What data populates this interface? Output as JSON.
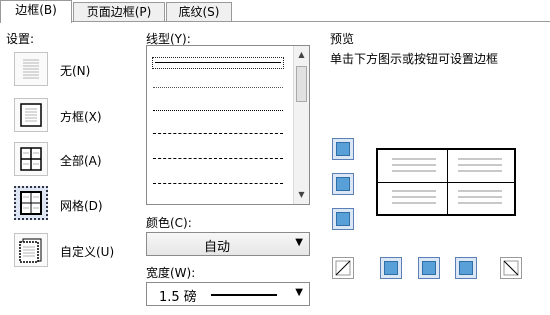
{
  "tabs": [
    {
      "label": "边框(B)",
      "active": true
    },
    {
      "label": "页面边框(P)",
      "active": false
    },
    {
      "label": "底纹(S)",
      "active": false
    }
  ],
  "settings": {
    "title": "设置:",
    "items": [
      {
        "label": "无(N)",
        "icon": "none-border-icon"
      },
      {
        "label": "方框(X)",
        "icon": "box-border-icon"
      },
      {
        "label": "全部(A)",
        "icon": "all-borders-icon"
      },
      {
        "label": "网格(D)",
        "icon": "grid-border-icon",
        "selected": true
      },
      {
        "label": "自定义(U)",
        "icon": "custom-border-icon"
      }
    ]
  },
  "line_style": {
    "title": "线型(Y):",
    "styles": [
      "solid",
      "dotted",
      "dashed-short",
      "dashed",
      "dash-dot",
      "dash-dot-dot"
    ],
    "selected": "solid"
  },
  "color": {
    "label": "颜色(C):",
    "value": "自动"
  },
  "width": {
    "label": "宽度(W):",
    "value": "1.5 磅"
  },
  "preview": {
    "title": "预览",
    "hint": "单击下方图示或按钮可设置边框"
  },
  "colors": {
    "accent": "#5aa0d8",
    "selected_bg": "#dfe6f3",
    "border": "#8b8b8b"
  }
}
